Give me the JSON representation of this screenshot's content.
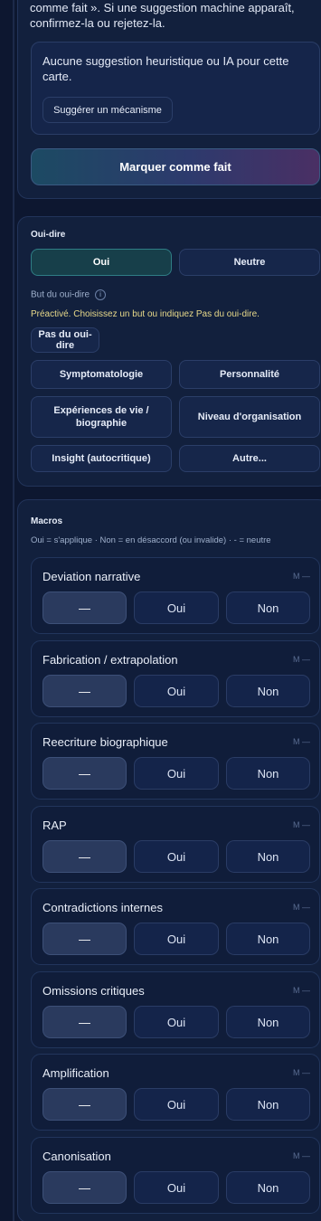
{
  "intro_text": "comme fait ». Si une suggestion machine apparaît, confirmez-la ou rejetez-la.",
  "suggestion": {
    "empty_text": "Aucune suggestion heuristique ou IA pour cette carte.",
    "suggest_button": "Suggérer un mécanisme"
  },
  "mark_done_button": "Marquer comme fait",
  "hearsay": {
    "title": "Oui-dire",
    "options": [
      "Oui",
      "Neutre"
    ],
    "selected": "Oui",
    "goal_label": "But du oui-dire",
    "info_icon": "i",
    "hint": "Préactivé. Choisissez un but ou indiquez Pas du oui-dire.",
    "not_hearsay_button": "Pas du oui-dire",
    "goals": [
      "Symptomatologie",
      "Personnalité",
      "Expériences de vie / biographie",
      "Niveau d'organisation",
      "Insight (autocritique)",
      "Autre..."
    ]
  },
  "macros": {
    "title": "Macros",
    "legend": "Oui = s'applique · Non = en désaccord (ou invalide) · - = neutre",
    "option_labels": [
      "—",
      "Oui",
      "Non"
    ],
    "items": [
      {
        "name": "Deviation narrative",
        "badge": "M —",
        "selected": "—"
      },
      {
        "name": "Fabrication / extrapolation",
        "badge": "M —",
        "selected": "—"
      },
      {
        "name": "Reecriture biographique",
        "badge": "M —",
        "selected": "—"
      },
      {
        "name": "RAP",
        "badge": "M —",
        "selected": "—"
      },
      {
        "name": "Contradictions internes",
        "badge": "M —",
        "selected": "—"
      },
      {
        "name": "Omissions critiques",
        "badge": "M —",
        "selected": "—"
      },
      {
        "name": "Amplification",
        "badge": "M —",
        "selected": "—"
      },
      {
        "name": "Canonisation",
        "badge": "M —",
        "selected": "—"
      }
    ]
  }
}
